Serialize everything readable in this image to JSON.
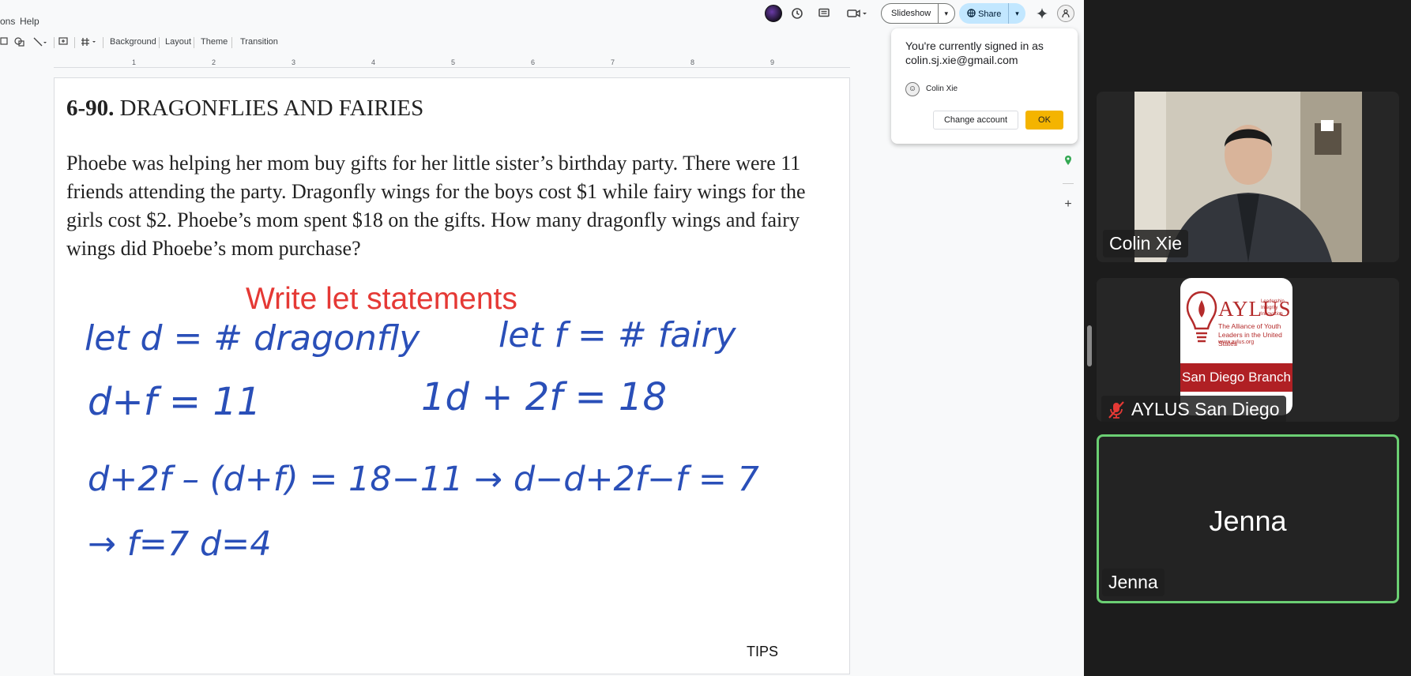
{
  "menubar": {
    "items": [
      "ons",
      "Help"
    ]
  },
  "topbar": {
    "slideshow_label": "Slideshow",
    "share_label": "Share",
    "icons": [
      "account-avatar",
      "history-icon",
      "comment-icon",
      "meet-icon",
      "gemini-icon",
      "profile-avatar"
    ]
  },
  "toolbar": {
    "items": [
      "Background",
      "Layout",
      "Theme",
      "Transition"
    ]
  },
  "ruler": {
    "numbers": [
      "1",
      "2",
      "3",
      "4",
      "5",
      "6",
      "7",
      "8",
      "9"
    ]
  },
  "slide": {
    "title_number": "6-90.",
    "title_text": " DRAGONFLIES AND FAIRIES",
    "problem": "Phoebe was helping her mom buy gifts for her little sister’s birthday party. There were 11 friends attending the party. Dragonfly wings for the boys cost $1 while fairy wings for the girls cost $2. Phoebe’s mom spent $18 on the gifts. How many dragonfly wings and fairy wings did Phoebe’s mom purchase?",
    "heading": "Write let statements",
    "handwriting": {
      "line1a": "let d = # dragonfly",
      "line1b": "let f = # fairy",
      "line2a": "d+f = 11",
      "line2b": "1d + 2f = 18",
      "line3": "d+2f – (d+f) = 18−11 → d−d+2f−f = 7",
      "line4": "→ f=7   d=4"
    },
    "tips": "TIPS"
  },
  "account_popup": {
    "line1": "You're currently signed in as",
    "email": "colin.sj.xie@gmail.com",
    "name": "Colin Xie",
    "change_account": "Change account",
    "ok": "OK"
  },
  "meeting": {
    "participants": [
      {
        "name": "Colin Xie",
        "video": true,
        "muted": false
      },
      {
        "name": "AYLUS San Diego",
        "video": false,
        "muted": true
      },
      {
        "name": "Jenna",
        "video": false,
        "muted": false,
        "active_speaker": true
      }
    ],
    "aylus_logo": {
      "brand": "AYLUS",
      "motto": "Leadership Integrity Innovation",
      "alliance": "The Alliance of Youth Leaders in the United States",
      "url": "www.aylus.org",
      "branch": "San Diego Branch"
    },
    "colors": {
      "active_border": "#6bcf73",
      "muted_icon": "#e53935",
      "share_bg": "#c2e7ff",
      "ok_bg": "#f4b400"
    }
  }
}
